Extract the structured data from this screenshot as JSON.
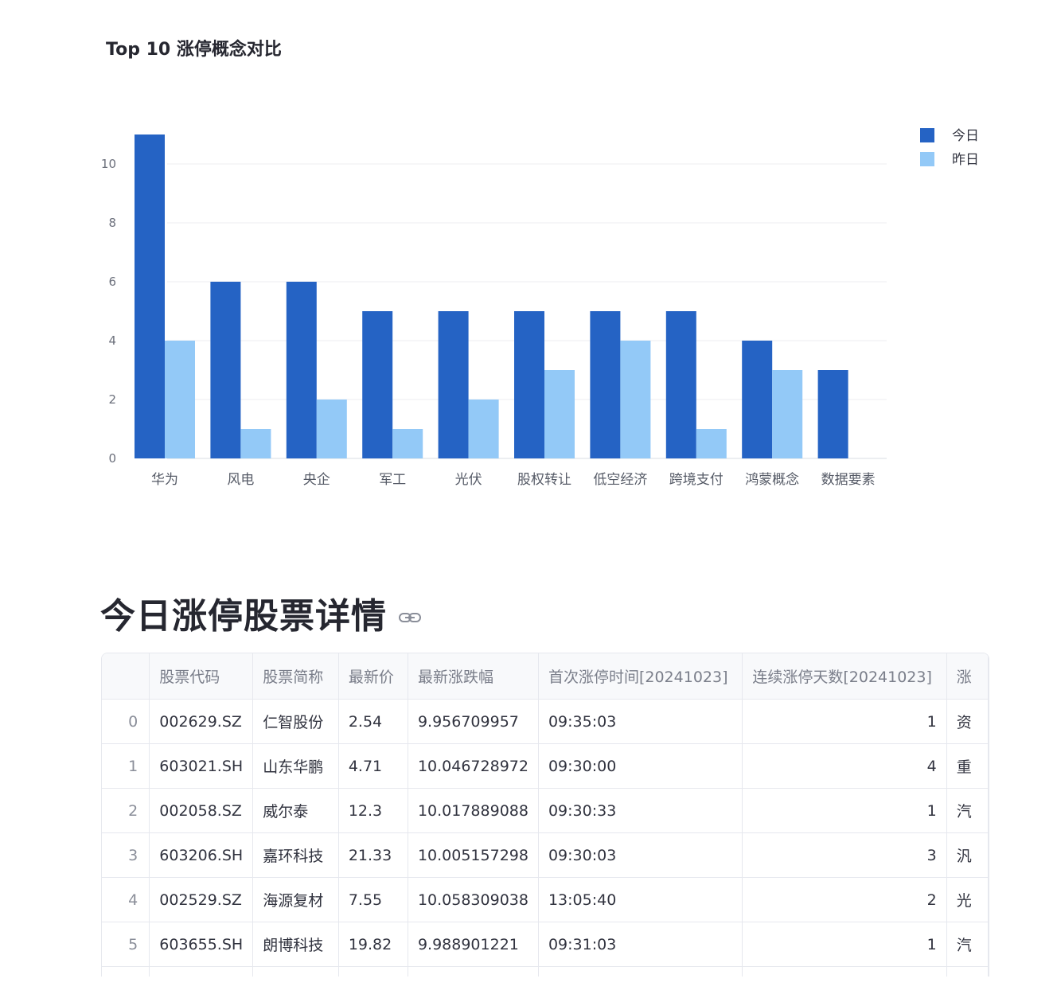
{
  "chart_data": {
    "type": "bar",
    "title": "Top 10 涨停概念对比",
    "categories": [
      "华为",
      "风电",
      "央企",
      "军工",
      "光伏",
      "股权转让",
      "低空经济",
      "跨境支付",
      "鸿蒙概念",
      "数据要素"
    ],
    "series": [
      {
        "name": "今日",
        "values": [
          11,
          6,
          6,
          5,
          5,
          5,
          5,
          5,
          4,
          3
        ],
        "color": "#2563c4"
      },
      {
        "name": "昨日",
        "values": [
          4,
          1,
          2,
          1,
          2,
          3,
          4,
          1,
          3,
          0
        ],
        "color": "#93c9f7"
      }
    ],
    "ylim": [
      0,
      11
    ],
    "yticks": [
      0,
      2,
      4,
      6,
      8,
      10
    ],
    "grid": true,
    "legend": "top-right"
  },
  "section": {
    "title": "今日涨停股票详情",
    "link_icon": "link-icon"
  },
  "table": {
    "columns": [
      "",
      "股票代码",
      "股票简称",
      "最新价",
      "最新涨跌幅",
      "首次涨停时间[20241023]",
      "连续涨停天数[20241023]",
      "涨"
    ],
    "rows": [
      [
        "0",
        "002629.SZ",
        "仁智股份",
        "2.54",
        "9.956709957",
        "09:35:03",
        "1",
        "资"
      ],
      [
        "1",
        "603021.SH",
        "山东华鹏",
        "4.71",
        "10.046728972",
        "09:30:00",
        "4",
        "重"
      ],
      [
        "2",
        "002058.SZ",
        "威尔泰",
        "12.3",
        "10.017889088",
        "09:30:33",
        "1",
        "汽"
      ],
      [
        "3",
        "603206.SH",
        "嘉环科技",
        "21.33",
        "10.005157298",
        "09:30:03",
        "3",
        "汎"
      ],
      [
        "4",
        "002529.SZ",
        "海源复材",
        "7.55",
        "10.058309038",
        "13:05:40",
        "2",
        "光"
      ],
      [
        "5",
        "603655.SH",
        "朗博科技",
        "19.82",
        "9.988901221",
        "09:31:03",
        "1",
        "汽"
      ]
    ]
  }
}
